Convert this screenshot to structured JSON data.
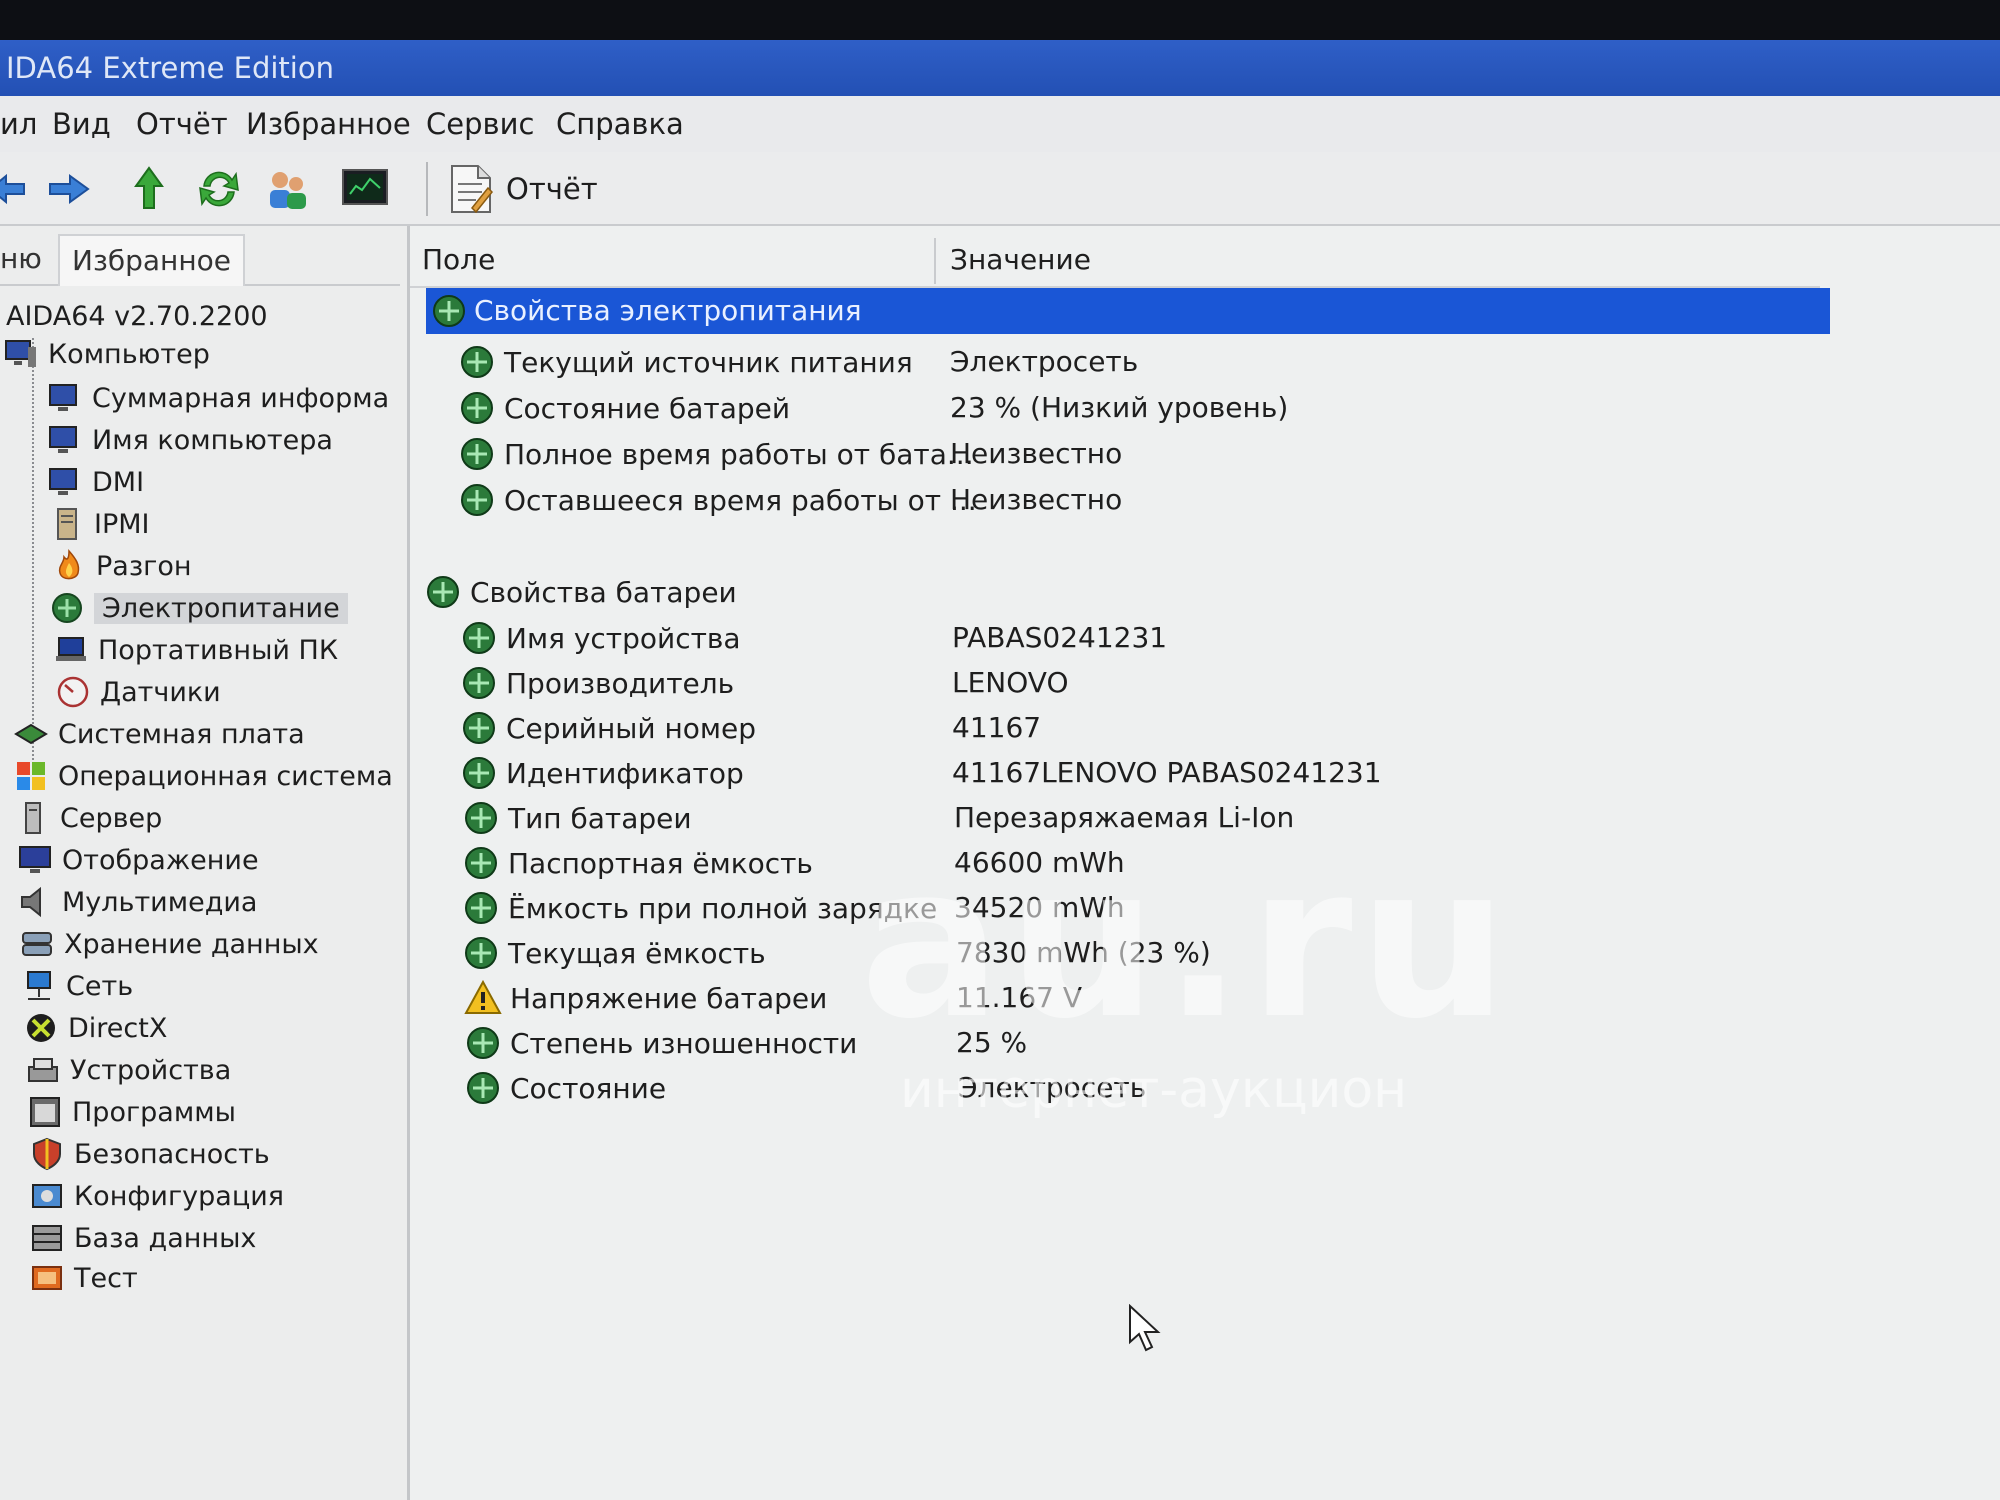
{
  "window": {
    "title": "IDA64 Extreme Edition"
  },
  "menu": [
    "ил",
    "Вид",
    "Отчёт",
    "Избранное",
    "Сервис",
    "Справка"
  ],
  "toolbar": {
    "report_label": "Отчёт"
  },
  "left_tabs": [
    "ню",
    "Избранное"
  ],
  "tree": {
    "root": "AIDA64 v2.70.2200",
    "computer": "Компьютер",
    "computer_children": [
      "Суммарная информа",
      "Имя компьютера",
      "DMI",
      "IPMI",
      "Разгон",
      "Электропитание",
      "Портативный ПК",
      "Датчики"
    ],
    "sections": [
      "Системная плата",
      "Операционная система",
      "Сервер",
      "Отображение",
      "Мультимедиа",
      "Хранение данных",
      "Сеть",
      "DirectX",
      "Устройства",
      "Программы",
      "Безопасность",
      "Конфигурация",
      "База данных",
      "Тест"
    ],
    "selected": "Электропитание"
  },
  "columns": {
    "field": "Поле",
    "value": "Значение"
  },
  "groups": [
    {
      "title": "Свойства электропитания",
      "rows": [
        {
          "field": "Текущий источник питания",
          "value": "Электросеть"
        },
        {
          "field": "Состояние батарей",
          "value": "23 % (Низкий уровень)"
        },
        {
          "field": "Полное время работы от бата...",
          "value": "Неизвестно"
        },
        {
          "field": "Оставшееся время работы от ...",
          "value": "Неизвестно"
        }
      ]
    },
    {
      "title": "Свойства батареи",
      "rows": [
        {
          "field": "Имя устройства",
          "value": "PABAS0241231"
        },
        {
          "field": "Производитель",
          "value": "LENOVO"
        },
        {
          "field": "Серийный номер",
          "value": "41167"
        },
        {
          "field": "Идентификатор",
          "value": "41167LENOVO PABAS0241231"
        },
        {
          "field": "Тип батареи",
          "value": "Перезаряжаемая Li-Ion"
        },
        {
          "field": "Паспортная ёмкость",
          "value": "46600 mWh"
        },
        {
          "field": "Ёмкость при полной зарядке",
          "value": "34520 mWh"
        },
        {
          "field": "Текущая ёмкость",
          "value": "7830 mWh  (23 %)"
        },
        {
          "field": "Напряжение батареи",
          "value": "11.167 V",
          "warning": true
        },
        {
          "field": "Степень изношенности",
          "value": "25 %"
        },
        {
          "field": "Состояние",
          "value": "Электросеть"
        }
      ]
    }
  ],
  "watermark": {
    "brand": "au.ru",
    "tagline": "интернет-аукцион"
  },
  "colors": {
    "titlebar": "#2350b4",
    "selection": "#1a56d6",
    "panel": "#eef0f0"
  }
}
